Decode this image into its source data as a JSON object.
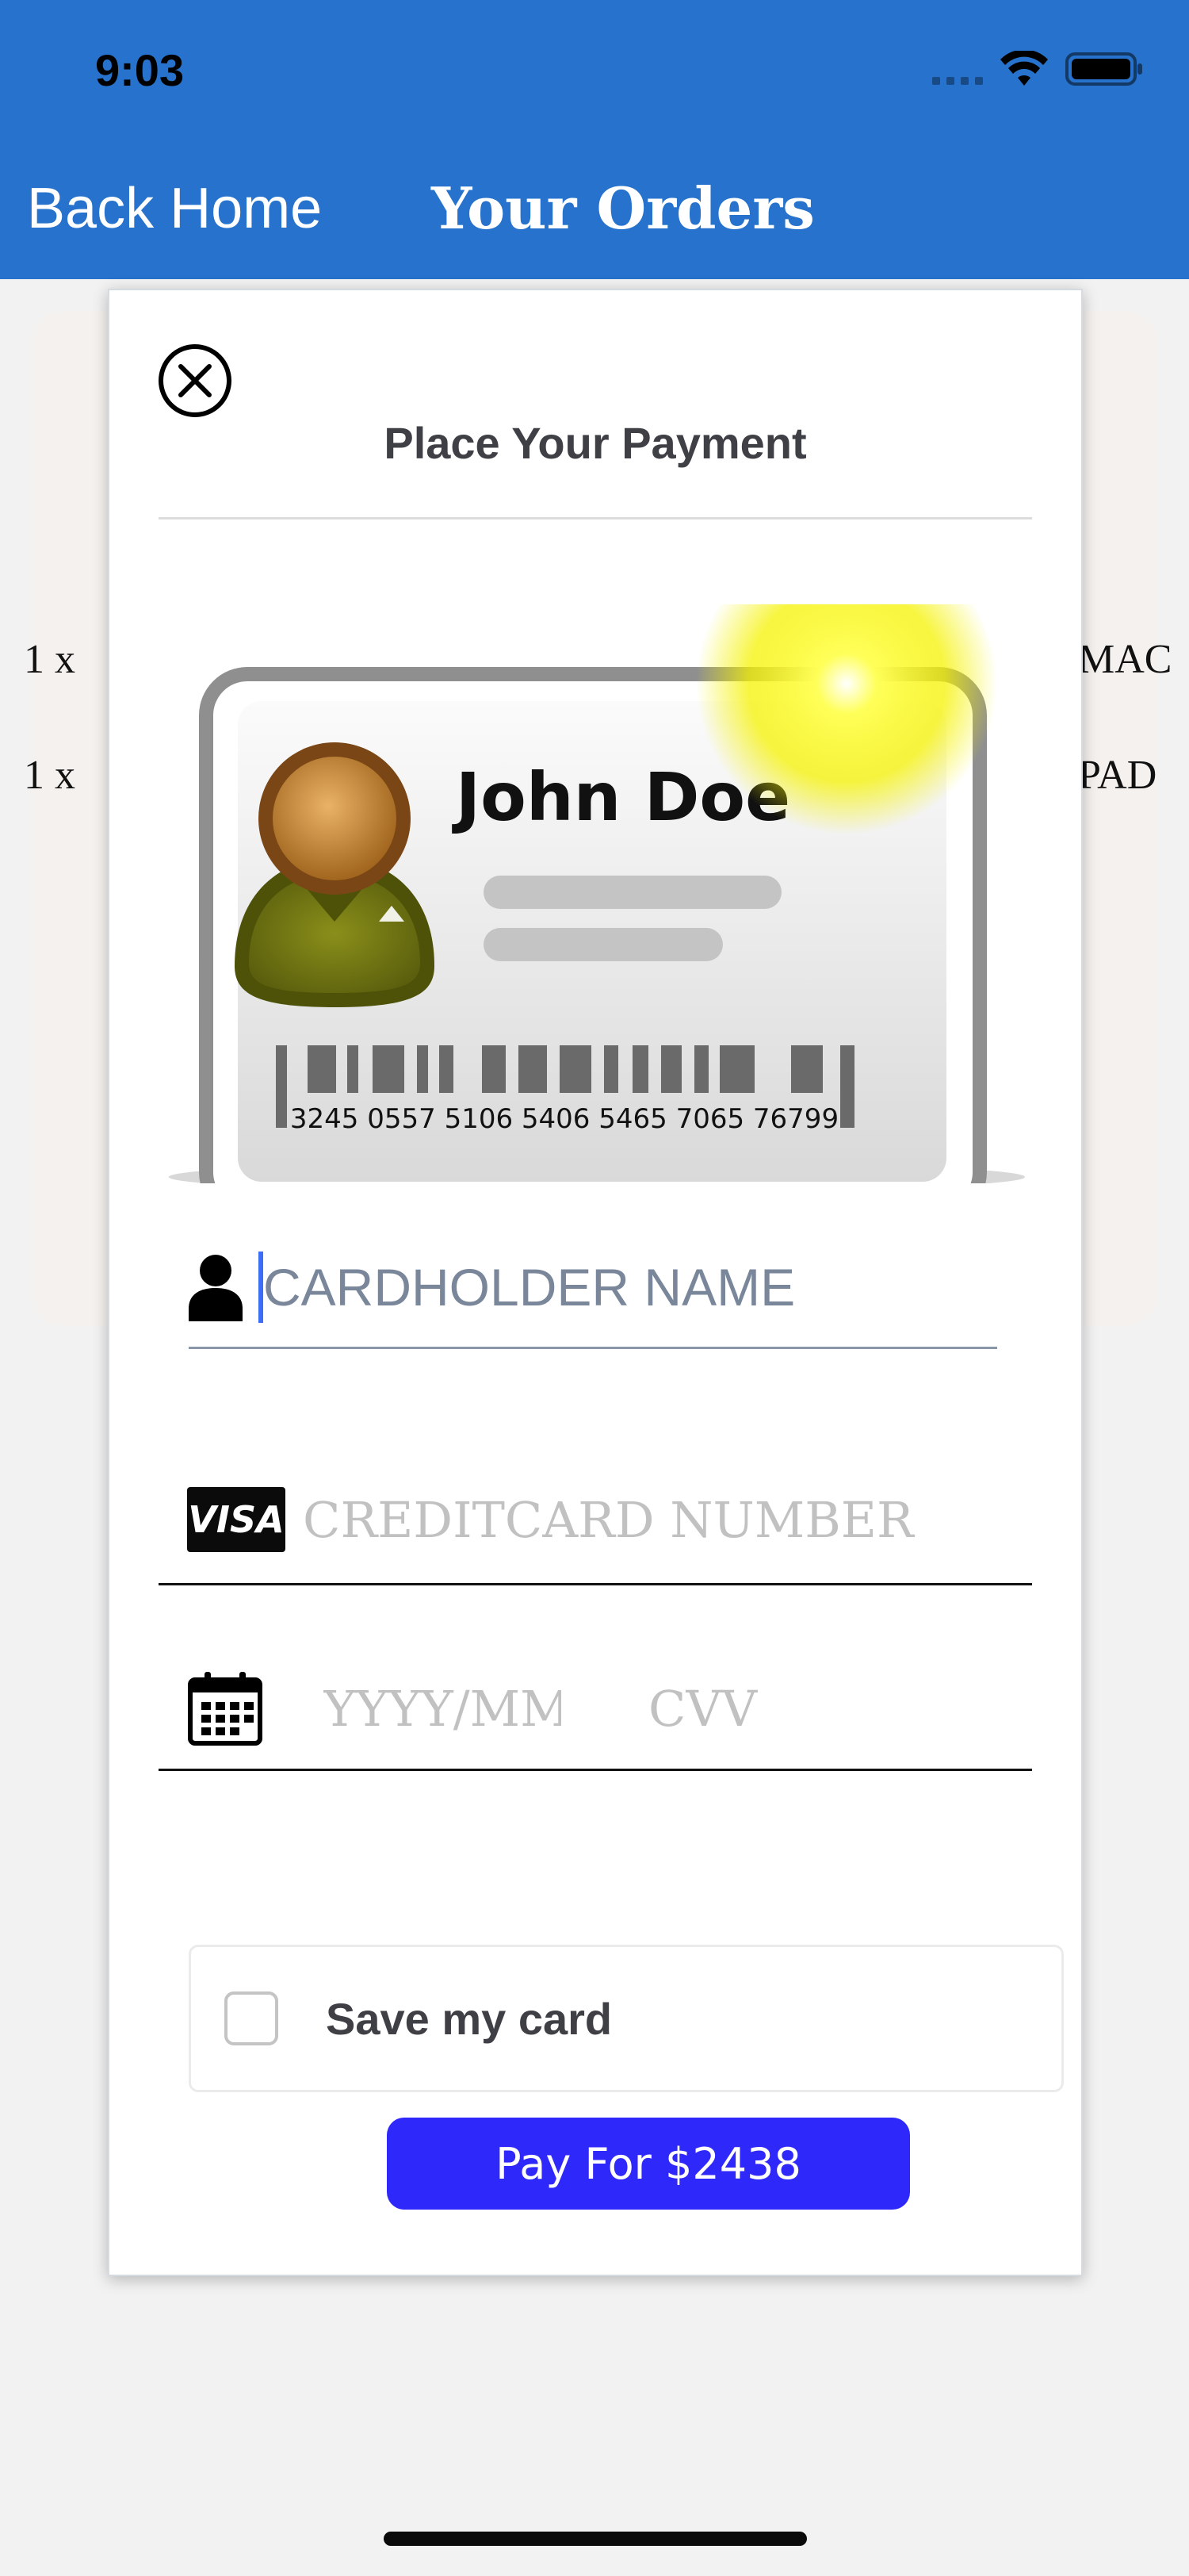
{
  "status_bar": {
    "time": "9:03"
  },
  "header": {
    "back_label": "Back Home",
    "title": "Your Orders"
  },
  "background_orders": [
    {
      "qty": "1 x",
      "name_tail": "MAC"
    },
    {
      "qty": "1 x",
      "name_tail": "PAD"
    }
  ],
  "modal": {
    "title": "Place Your Payment",
    "card_preview": {
      "holder_name": "John Doe",
      "barcode_number": "3245 0557 5106 5406 5465 7065 76799"
    },
    "name_field": {
      "placeholder": "CARDHOLDER NAME",
      "value": ""
    },
    "card_field": {
      "brand": "VISA",
      "placeholder": "CREDITCARD NUMBER",
      "value": ""
    },
    "expiry_field": {
      "placeholder": "YYYY/MM",
      "value": ""
    },
    "cvv_field": {
      "placeholder": "CVV",
      "value": ""
    },
    "save_card": {
      "label": "Save my card",
      "checked": false
    },
    "pay_button": {
      "label": "Pay For $2438"
    }
  },
  "colors": {
    "header": "#2672cc",
    "pay_button": "#2f28fb",
    "caret": "#3b6ef5"
  },
  "icons": [
    "close-icon",
    "person-icon",
    "visa-icon",
    "calendar-icon",
    "wifi-icon",
    "battery-icon"
  ]
}
